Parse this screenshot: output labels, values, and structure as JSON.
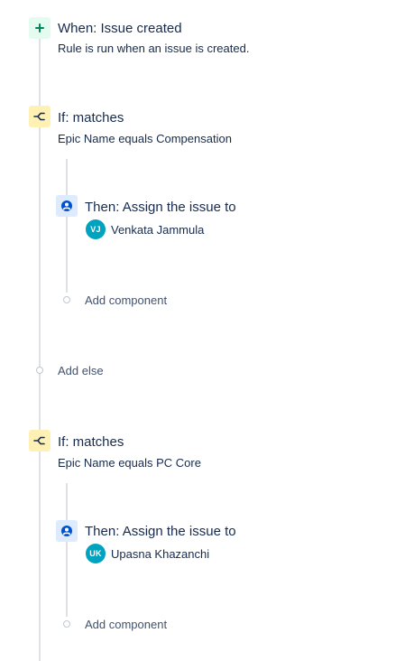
{
  "trigger": {
    "title": "When: Issue created",
    "description": "Rule is run when an issue is created."
  },
  "conditions": [
    {
      "title": "If: matches",
      "description": "Epic Name equals Compensation",
      "action": {
        "title": "Then: Assign the issue to",
        "assignee_initials": "VJ",
        "assignee_name": "Venkata Jammula"
      },
      "add_component_label": "Add component"
    },
    {
      "title": "If: matches",
      "description": "Epic Name equals PC Core",
      "action": {
        "title": "Then: Assign the issue to",
        "assignee_initials": "UK",
        "assignee_name": "Upasna Khazanchi"
      },
      "add_component_label": "Add component"
    }
  ],
  "add_else_label": "Add else",
  "colors": {
    "trigger_bg": "#e3fcef",
    "trigger_icon": "#00875a",
    "condition_bg": "#fff0b3",
    "condition_icon": "#172b4d",
    "action_bg": "#deebff",
    "action_icon": "#0052cc",
    "avatar_bg": "#00a3bf",
    "connector": "#dfe1e6"
  },
  "icons": {
    "trigger": "plus-icon",
    "condition": "branch-icon",
    "action": "user-circle-icon"
  }
}
